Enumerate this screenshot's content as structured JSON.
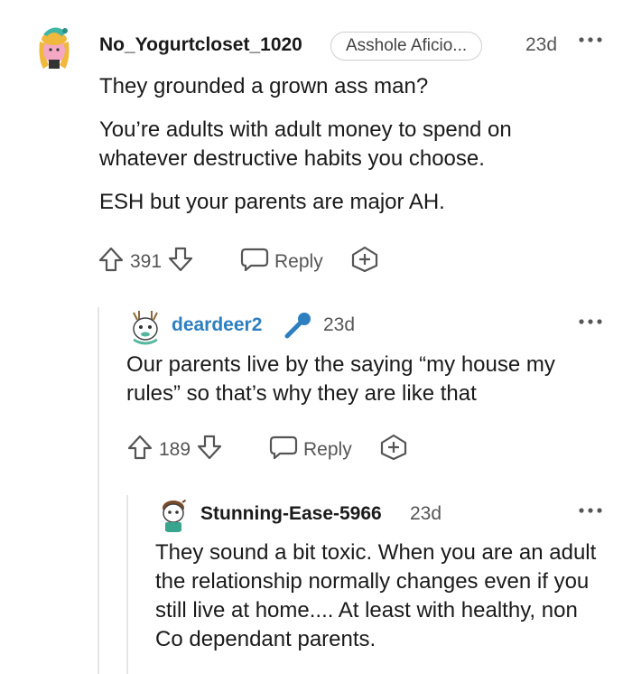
{
  "comments": [
    {
      "username": "No_Yogurtcloset_1020",
      "flair": "Asshole Aficio...",
      "timestamp": "23d",
      "paragraphs": [
        "They grounded a grown ass man?",
        "You’re adults with adult money to spend on whatever destructive habits you choose.",
        "ESH but your parents are major AH."
      ],
      "votes": "391",
      "reply_label": "Reply"
    },
    {
      "username": "deardeer2",
      "timestamp": "23d",
      "paragraphs": [
        "Our parents live by the saying “my house my rules” so that’s why they are like that"
      ],
      "votes": "189",
      "reply_label": "Reply"
    },
    {
      "username": "Stunning-Ease-5966",
      "timestamp": "23d",
      "paragraphs": [
        "They sound a bit toxic. When you are an adult the relationship normally changes even if you still live at home.... At least with healthy, non Co dependant parents."
      ]
    }
  ],
  "icons": {
    "more": "more-options-icon",
    "upvote": "upvote-arrow-icon",
    "downvote": "downvote-arrow-icon",
    "reply": "speech-bubble-icon",
    "award": "award-plus-icon",
    "mic": "microphone-icon"
  },
  "colors": {
    "username_highlight": "#2e7fc0",
    "mic": "#2e7fc0"
  }
}
